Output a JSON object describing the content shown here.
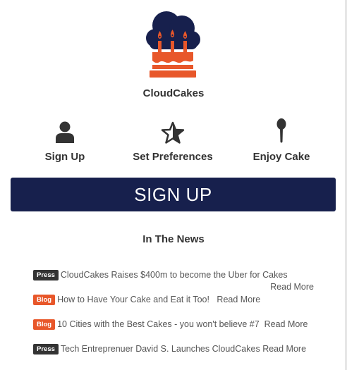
{
  "brand": {
    "name": "CloudCakes"
  },
  "steps": [
    {
      "label": "Sign Up",
      "icon": "user-icon"
    },
    {
      "label": "Set Preferences",
      "icon": "star-icon"
    },
    {
      "label": "Enjoy Cake",
      "icon": "spoon-icon"
    }
  ],
  "cta": {
    "label": "SIGN UP"
  },
  "news": {
    "title": "In The News",
    "read_more": "Read More",
    "items": [
      {
        "tag": "Press",
        "headline": "CloudCakes Raises $400m to become the Uber for Cakes"
      },
      {
        "tag": "Blog",
        "headline": "How to Have Your Cake and Eat it Too!"
      },
      {
        "tag": "Blog",
        "headline": "10 Cities with the Best Cakes - you won't believe #7"
      },
      {
        "tag": "Press",
        "headline": "Tech Entreprenuer David S. Launches CloudCakes"
      }
    ]
  },
  "colors": {
    "navy": "#17204d",
    "orange": "#e8572a",
    "press_tag": "#333333"
  }
}
